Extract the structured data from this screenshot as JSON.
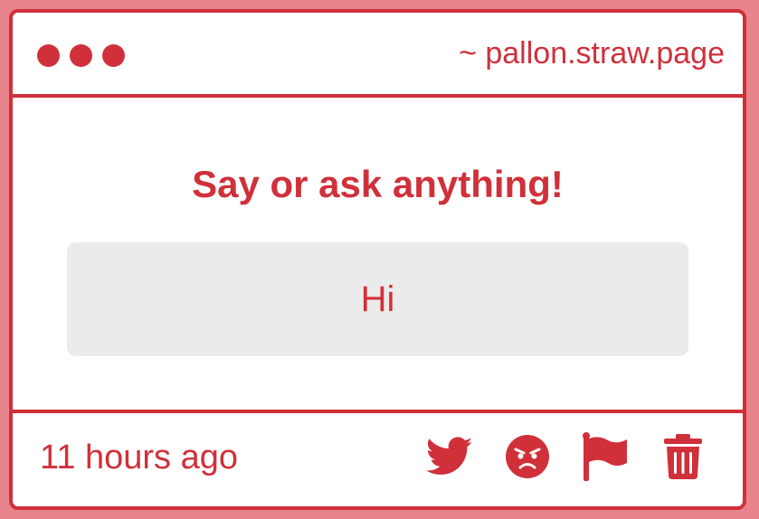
{
  "window": {
    "url": "~ pallon.straw.page"
  },
  "main": {
    "heading": "Say or ask anything!",
    "message": "Hi"
  },
  "footer": {
    "timestamp": "11 hours ago",
    "actions": [
      {
        "icon": "twitter-bird-icon",
        "label": "share-on-twitter"
      },
      {
        "icon": "angry-face-icon",
        "label": "react-angry"
      },
      {
        "icon": "flag-icon",
        "label": "report"
      },
      {
        "icon": "trash-icon",
        "label": "delete"
      }
    ]
  },
  "colors": {
    "accent": "#d0303a",
    "backdrop": "#e8858c",
    "card": "#ffffff",
    "message_bg": "#ecebec"
  }
}
